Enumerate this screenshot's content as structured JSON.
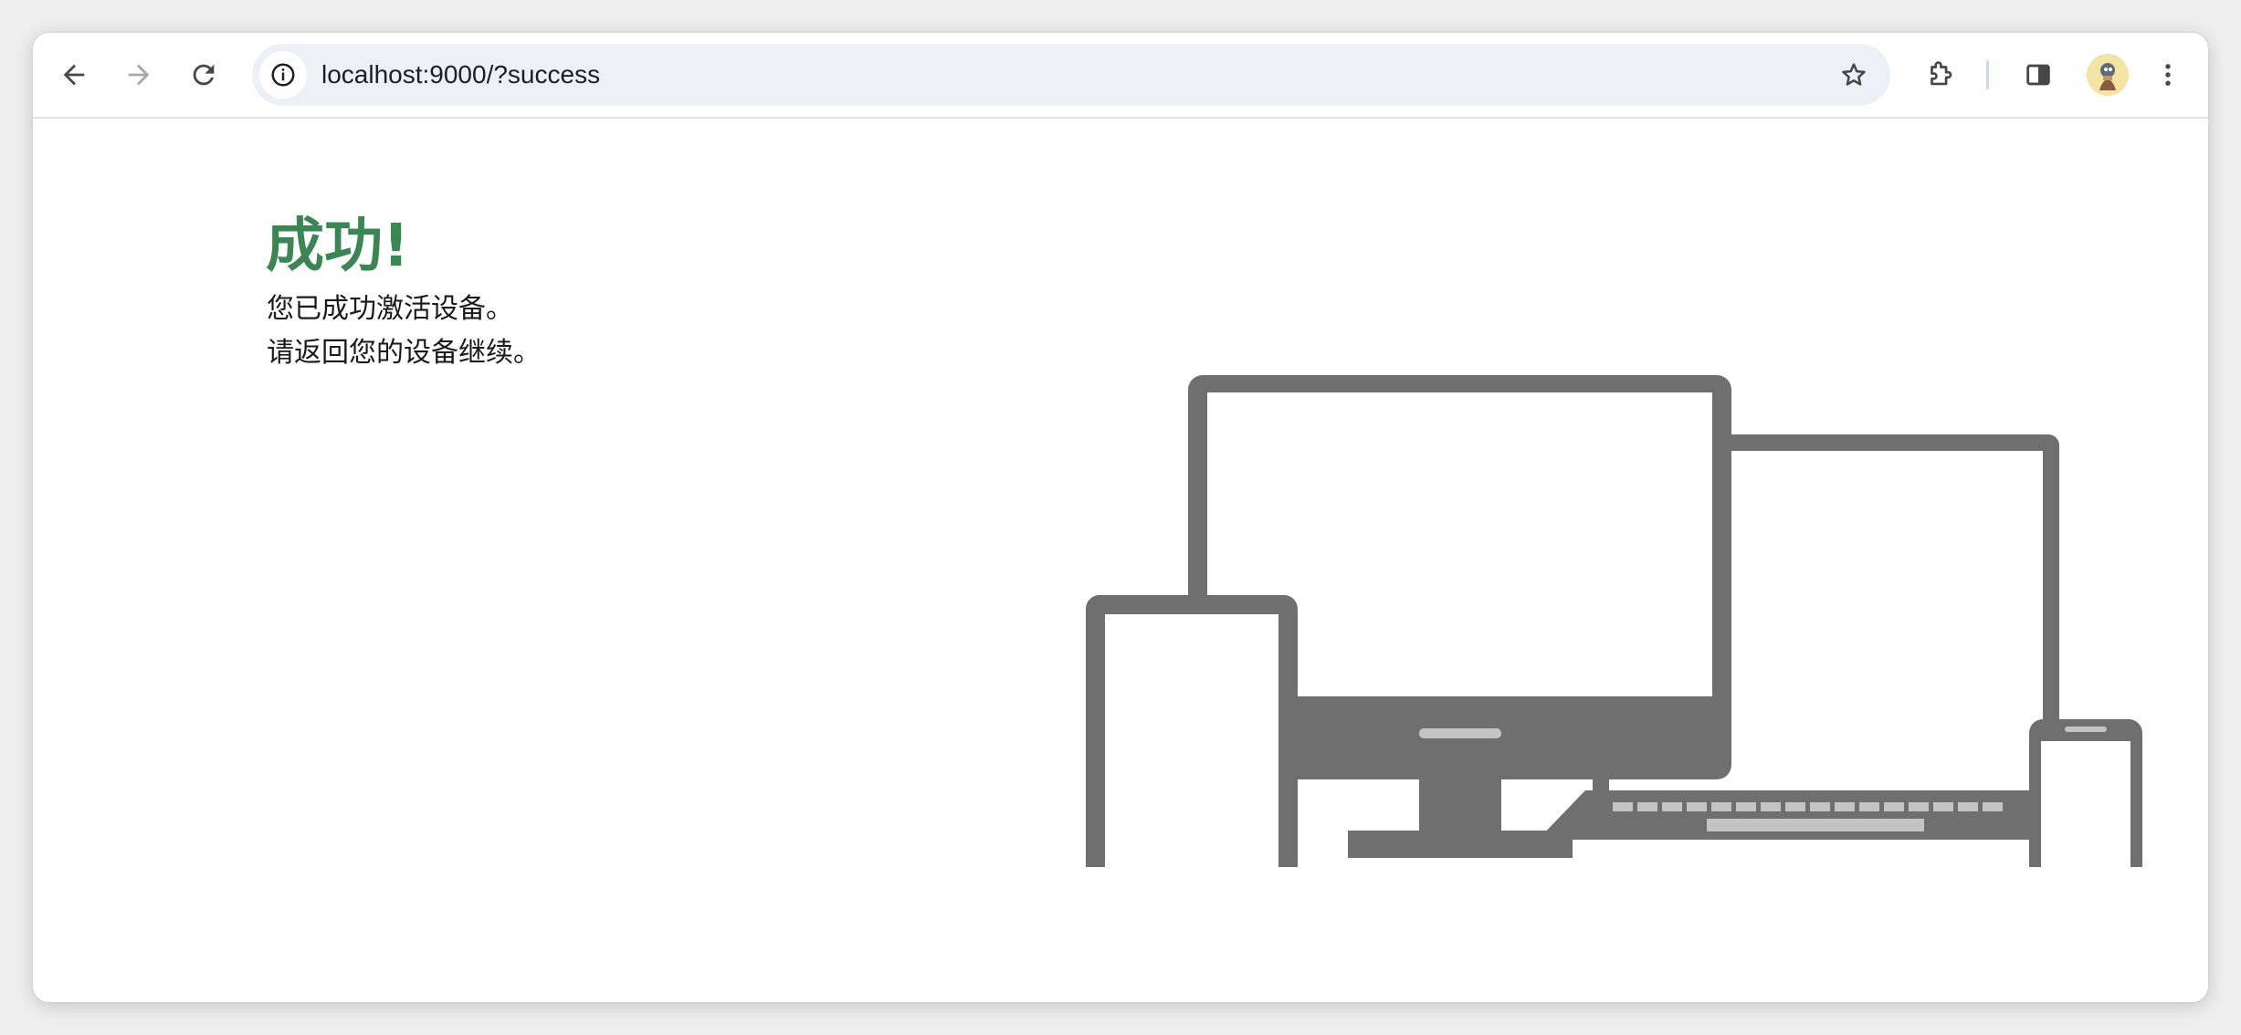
{
  "browser": {
    "url": "localhost:9000/?success",
    "icons": {
      "back": "arrow-left-icon",
      "forward": "arrow-right-icon",
      "reload": "reload-icon",
      "site_info": "info-icon",
      "bookmark": "star-icon",
      "extensions": "puzzle-icon",
      "side_panel": "side-panel-icon",
      "profile": "avatar",
      "menu": "kebab-menu-icon"
    }
  },
  "page": {
    "title": "成功!",
    "message_line1": "您已成功激活设备。",
    "message_line2": "请返回您的设备继续。",
    "illustration": "devices-illustration",
    "colors": {
      "title": "#3c8656",
      "device_gray": "#6f6f6f",
      "omnibox_bg": "#edf0f6"
    }
  }
}
